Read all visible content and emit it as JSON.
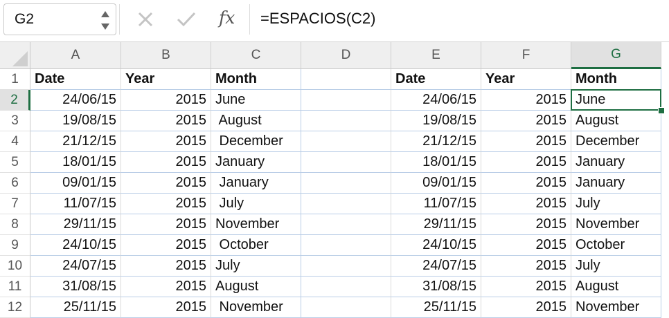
{
  "name_box": "G2",
  "formula": "=ESPACIOS(C2)",
  "fx_label": "fx",
  "columns": [
    "A",
    "B",
    "C",
    "D",
    "E",
    "F",
    "G"
  ],
  "selected_column": "G",
  "selected_row": "2",
  "row_numbers": [
    "1",
    "2",
    "3",
    "4",
    "5",
    "6",
    "7",
    "8",
    "9",
    "10",
    "11",
    "12"
  ],
  "left_headers": [
    "Date",
    "Year",
    "Month"
  ],
  "right_headers": [
    "Date",
    "Year",
    "Month"
  ],
  "left_rows": [
    [
      "24/06/15",
      "2015",
      "June"
    ],
    [
      "19/08/15",
      "2015",
      " August"
    ],
    [
      "21/12/15",
      "2015",
      " December"
    ],
    [
      "18/01/15",
      "2015",
      "January"
    ],
    [
      "09/01/15",
      "2015",
      " January"
    ],
    [
      "11/07/15",
      "2015",
      " July"
    ],
    [
      "29/11/15",
      "2015",
      "November"
    ],
    [
      "24/10/15",
      "2015",
      " October"
    ],
    [
      "24/07/15",
      "2015",
      "July"
    ],
    [
      "31/08/15",
      "2015",
      "August"
    ],
    [
      "25/11/15",
      "2015",
      " November"
    ]
  ],
  "right_rows": [
    [
      "24/06/15",
      "2015",
      "June"
    ],
    [
      "19/08/15",
      "2015",
      "August"
    ],
    [
      "21/12/15",
      "2015",
      "December"
    ],
    [
      "18/01/15",
      "2015",
      "January"
    ],
    [
      "09/01/15",
      "2015",
      "January"
    ],
    [
      "11/07/15",
      "2015",
      "July"
    ],
    [
      "29/11/15",
      "2015",
      "November"
    ],
    [
      "24/10/15",
      "2015",
      "October"
    ],
    [
      "24/07/15",
      "2015",
      "July"
    ],
    [
      "31/08/15",
      "2015",
      "August"
    ],
    [
      "25/11/15",
      "2015",
      "November"
    ]
  ],
  "colors": {
    "accent": "#1e6e42",
    "gridline": "#b9cde6",
    "header_bg": "#efefef"
  },
  "icons": [
    "stepper-icon",
    "cancel-icon",
    "confirm-icon",
    "fx-icon"
  ]
}
